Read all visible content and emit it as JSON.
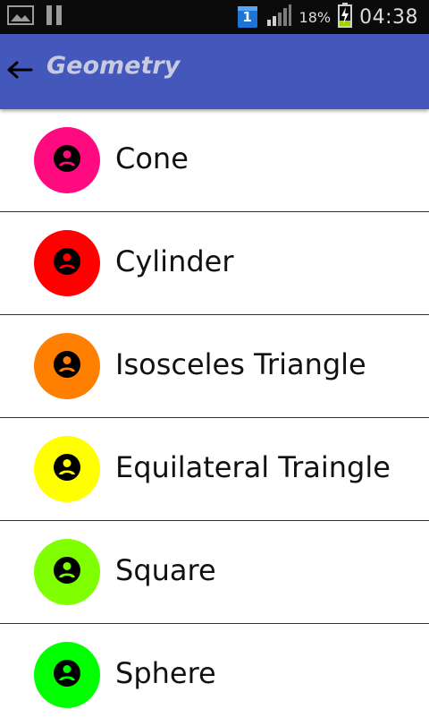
{
  "status_bar": {
    "time": "04:38",
    "battery_percent": "18%",
    "notification_badge": "1",
    "icons": [
      "image-icon",
      "pause-icon",
      "calendar-badge-icon",
      "signal-icon",
      "battery-charging-icon"
    ]
  },
  "app_bar": {
    "title": "Geometry",
    "back_icon": "arrow-left-icon",
    "color": "#4457bb"
  },
  "shapes": [
    {
      "label": "Cone",
      "color": "#ff0a7f",
      "icon": "account-circle-icon"
    },
    {
      "label": "Cylinder",
      "color": "#ff0000",
      "icon": "account-circle-icon"
    },
    {
      "label": "Isosceles Triangle",
      "color": "#ff7f00",
      "icon": "account-circle-icon"
    },
    {
      "label": "Equilateral Traingle",
      "color": "#ffff00",
      "icon": "account-circle-icon"
    },
    {
      "label": "Square",
      "color": "#7fff00",
      "icon": "account-circle-icon"
    },
    {
      "label": "Sphere",
      "color": "#00ff00",
      "icon": "account-circle-icon"
    }
  ]
}
